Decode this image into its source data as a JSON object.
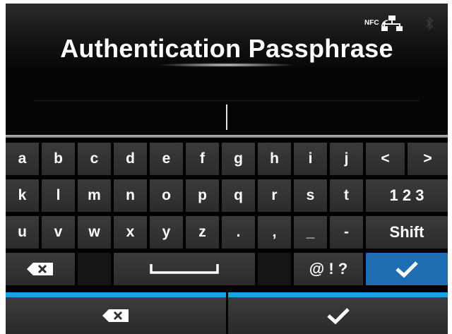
{
  "header": {
    "title": "Authentication Passphrase",
    "nfc_label": "NFC",
    "icons": [
      "nfc-icon",
      "wired-network-icon",
      "bluetooth-icon"
    ]
  },
  "input": {
    "value": ""
  },
  "keyboard": {
    "row1": [
      "a",
      "b",
      "c",
      "d",
      "e",
      "f",
      "g",
      "h",
      "i",
      "j",
      "<",
      ">"
    ],
    "row2": [
      "k",
      "l",
      "m",
      "n",
      "o",
      "p",
      "q",
      "r",
      "s",
      "t",
      "1 2 3"
    ],
    "row3": [
      "u",
      "v",
      "w",
      "x",
      "y",
      "z",
      ".",
      ",",
      "_",
      "-",
      "Shift"
    ],
    "row4": {
      "backspace_icon": "backspace-icon",
      "space_icon": "space-bar-icon",
      "symbols": "@ ! ?",
      "enter_icon": "checkmark-icon"
    }
  },
  "bottom_bar": {
    "left_icon": "backspace-icon",
    "right_icon": "checkmark-icon"
  },
  "colors": {
    "accent": "#1f6eb4",
    "strip": "#15a2e0",
    "key_bg": "#333333"
  }
}
